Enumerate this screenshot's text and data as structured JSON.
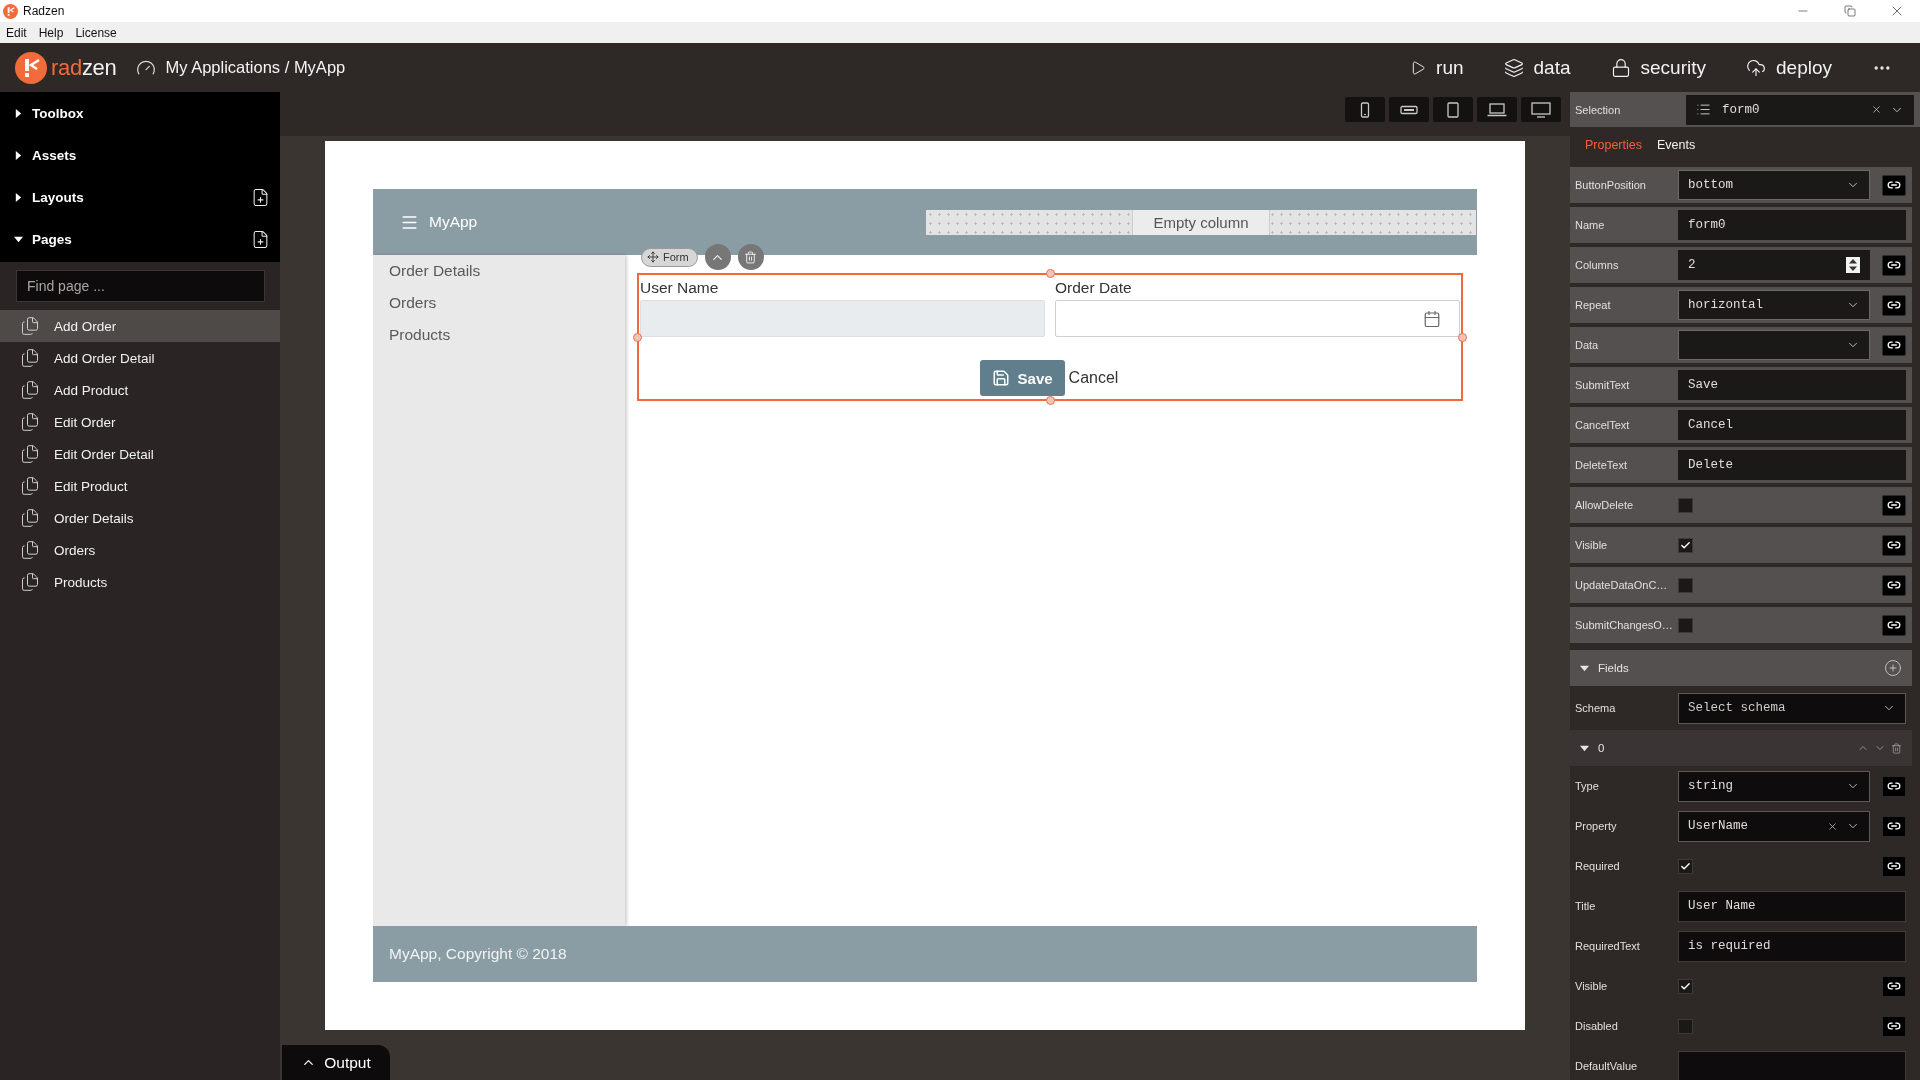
{
  "window": {
    "title": "Radzen"
  },
  "menu": [
    {
      "label": "Edit"
    },
    {
      "label": "Help"
    },
    {
      "label": "License"
    }
  ],
  "app_bar": {
    "logo": {
      "accent_text": "rad",
      "text": "zen"
    },
    "breadcrumb": "My Applications / MyApp",
    "actions": [
      {
        "kind": "run",
        "label": "run"
      },
      {
        "kind": "data",
        "label": "data"
      },
      {
        "kind": "security",
        "label": "security"
      },
      {
        "kind": "deploy",
        "label": "deploy"
      }
    ]
  },
  "sidebar": {
    "sections": [
      {
        "label": "Toolbox",
        "expanded": false,
        "can_add": false
      },
      {
        "label": "Assets",
        "expanded": false,
        "can_add": false
      },
      {
        "label": "Layouts",
        "expanded": false,
        "can_add": true
      },
      {
        "label": "Pages",
        "expanded": true,
        "can_add": true,
        "search": {
          "placeholder": "Find page ..."
        },
        "items": [
          {
            "label": "Add Order",
            "selected": true
          },
          {
            "label": "Add Order Detail",
            "selected": false
          },
          {
            "label": "Add Product",
            "selected": false
          },
          {
            "label": "Edit Order",
            "selected": false
          },
          {
            "label": "Edit Order Detail",
            "selected": false
          },
          {
            "label": "Edit Product",
            "selected": false
          },
          {
            "label": "Order Details",
            "selected": false
          },
          {
            "label": "Orders",
            "selected": false
          },
          {
            "label": "Products",
            "selected": false
          }
        ]
      }
    ]
  },
  "canvas": {
    "header": {
      "title": "MyApp",
      "empty_column_label": "Empty column"
    },
    "nav": [
      {
        "label": "Order Details"
      },
      {
        "label": "Orders"
      },
      {
        "label": "Products"
      }
    ],
    "form": {
      "tag": "Form",
      "fields": [
        {
          "kind": "text",
          "label": "User Name"
        },
        {
          "kind": "date",
          "label": "Order Date"
        }
      ],
      "submit": "Save",
      "cancel": "Cancel"
    },
    "footer": "MyApp, Copyright © 2018"
  },
  "output": {
    "label": "Output"
  },
  "properties_panel": {
    "selection": {
      "label": "Selection",
      "value": "form0",
      "clearable": true
    },
    "tabs": [
      {
        "label": "Properties",
        "selected": true
      },
      {
        "label": "Events",
        "selected": false
      }
    ],
    "rows": [
      {
        "kind": "select",
        "label": "ButtonPosition",
        "value": "bottom",
        "bindable": true,
        "clearable": false
      },
      {
        "kind": "text",
        "label": "Name",
        "value": "form0",
        "bindable": false
      },
      {
        "kind": "number",
        "label": "Columns",
        "value": "2",
        "bindable": true
      },
      {
        "kind": "select",
        "label": "Repeat",
        "value": "horizontal",
        "bindable": true,
        "clearable": false
      },
      {
        "kind": "select",
        "label": "Data",
        "bindable": true,
        "clearable": false
      },
      {
        "kind": "text",
        "label": "SubmitText",
        "value": "Save",
        "bindable": false
      },
      {
        "kind": "text",
        "label": "CancelText",
        "value": "Cancel",
        "bindable": false
      },
      {
        "kind": "text",
        "label": "DeleteText",
        "value": "Delete",
        "bindable": false
      },
      {
        "kind": "checkbox",
        "label": "AllowDelete",
        "checked": false,
        "bindable": true
      },
      {
        "kind": "checkbox",
        "label": "Visible",
        "checked": true,
        "bindable": true
      },
      {
        "kind": "checkbox",
        "label": "UpdateDataOnC…",
        "checked": false,
        "bindable": true
      },
      {
        "kind": "checkbox",
        "label": "SubmitChangesO…",
        "checked": false,
        "bindable": true
      }
    ],
    "fields": {
      "label": "Fields",
      "expanded": true,
      "schema": {
        "kind": "select",
        "label": "Schema",
        "placeholder": "Select schema",
        "bindable": false,
        "clearable": false
      },
      "items": [
        {
          "label": "0",
          "expanded": true,
          "rows": [
            {
              "kind": "select",
              "label": "Type",
              "value": "string",
              "bindable": true,
              "clearable": false
            },
            {
              "kind": "select",
              "label": "Property",
              "value": "UserName",
              "bindable": true,
              "clearable": true
            },
            {
              "kind": "checkbox",
              "label": "Required",
              "checked": true,
              "bindable": true
            },
            {
              "kind": "text",
              "label": "Title",
              "value": "User Name",
              "bindable": false
            },
            {
              "kind": "text",
              "label": "RequiredText",
              "value": "is required",
              "bindable": false
            },
            {
              "kind": "checkbox",
              "label": "Visible",
              "checked": true,
              "bindable": true
            },
            {
              "kind": "checkbox",
              "label": "Disabled",
              "checked": false,
              "bindable": true
            },
            {
              "kind": "text",
              "label": "DefaultValue",
              "bindable": false
            }
          ]
        }
      ]
    }
  }
}
